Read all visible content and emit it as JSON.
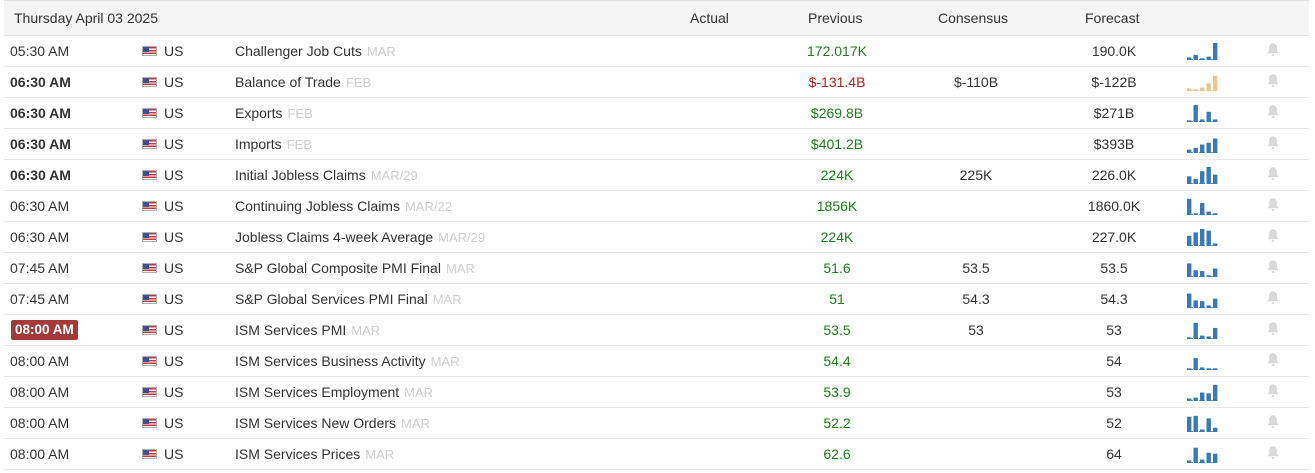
{
  "header": {
    "date": "Thursday April 03 2025",
    "actual": "Actual",
    "previous": "Previous",
    "consensus": "Consensus",
    "forecast": "Forecast"
  },
  "colors": {
    "positive": "#1a7f1a",
    "negative": "#b52020",
    "highlight_time": "#a33a3a",
    "spark_blue": "#3a79b7",
    "spark_warn": "#ecc88c"
  },
  "rows": [
    {
      "time": "05:30 AM",
      "bold": false,
      "highlight": false,
      "country": "US",
      "event": "Challenger Job Cuts",
      "ref": "MAR",
      "actual": "",
      "previous": "172.017K",
      "prev_tone": "pos",
      "consensus": "",
      "forecast": "190.0K",
      "spark": [
        0.15,
        0.3,
        0.1,
        0.2,
        1.0
      ],
      "spark_style": "blue"
    },
    {
      "time": "06:30 AM",
      "bold": true,
      "highlight": false,
      "country": "US",
      "event": "Balance of Trade",
      "ref": "FEB",
      "actual": "",
      "previous": "$-131.4B",
      "prev_tone": "neg",
      "consensus": "$-110B",
      "forecast": "$-122B",
      "spark": [
        0.15,
        0.1,
        0.2,
        0.45,
        0.9
      ],
      "spark_style": "warn"
    },
    {
      "time": "06:30 AM",
      "bold": true,
      "highlight": false,
      "country": "US",
      "event": "Exports",
      "ref": "FEB",
      "actual": "",
      "previous": "$269.8B",
      "prev_tone": "pos",
      "consensus": "",
      "forecast": "$271B",
      "spark": [
        0.1,
        1.0,
        0.15,
        0.6,
        0.15
      ],
      "spark_style": "blue"
    },
    {
      "time": "06:30 AM",
      "bold": true,
      "highlight": false,
      "country": "US",
      "event": "Imports",
      "ref": "FEB",
      "actual": "",
      "previous": "$401.2B",
      "prev_tone": "pos",
      "consensus": "",
      "forecast": "$393B",
      "spark": [
        0.2,
        0.3,
        0.5,
        0.6,
        0.85
      ],
      "spark_style": "blue"
    },
    {
      "time": "06:30 AM",
      "bold": true,
      "highlight": false,
      "country": "US",
      "event": "Initial Jobless Claims",
      "ref": "MAR/29",
      "actual": "",
      "previous": "224K",
      "prev_tone": "pos",
      "consensus": "225K",
      "forecast": "226.0K",
      "spark": [
        0.45,
        0.3,
        0.75,
        1.0,
        0.55
      ],
      "spark_style": "blue"
    },
    {
      "time": "06:30 AM",
      "bold": false,
      "highlight": false,
      "country": "US",
      "event": "Continuing Jobless Claims",
      "ref": "MAR/22",
      "actual": "",
      "previous": "1856K",
      "prev_tone": "pos",
      "consensus": "",
      "forecast": "1860.0K",
      "spark": [
        0.95,
        0.1,
        0.7,
        0.2,
        0.1
      ],
      "spark_style": "blue"
    },
    {
      "time": "06:30 AM",
      "bold": false,
      "highlight": false,
      "country": "US",
      "event": "Jobless Claims 4-week Average",
      "ref": "MAR/29",
      "actual": "",
      "previous": "224K",
      "prev_tone": "pos",
      "consensus": "",
      "forecast": "227.0K",
      "spark": [
        0.6,
        0.8,
        1.0,
        0.9,
        0.15
      ],
      "spark_style": "blue"
    },
    {
      "time": "07:45 AM",
      "bold": false,
      "highlight": false,
      "country": "US",
      "event": "S&P Global Composite PMI Final",
      "ref": "MAR",
      "actual": "",
      "previous": "51.6",
      "prev_tone": "pos",
      "consensus": "53.5",
      "forecast": "53.5",
      "spark": [
        0.8,
        0.4,
        0.35,
        0.1,
        0.5
      ],
      "spark_style": "blue"
    },
    {
      "time": "07:45 AM",
      "bold": false,
      "highlight": false,
      "country": "US",
      "event": "S&P Global Services PMI Final",
      "ref": "MAR",
      "actual": "",
      "previous": "51",
      "prev_tone": "pos",
      "consensus": "54.3",
      "forecast": "54.3",
      "spark": [
        0.85,
        0.45,
        0.4,
        0.15,
        0.55
      ],
      "spark_style": "blue"
    },
    {
      "time": "08:00 AM",
      "bold": true,
      "highlight": true,
      "country": "US",
      "event": "ISM Services PMI",
      "ref": "MAR",
      "actual": "",
      "previous": "53.5",
      "prev_tone": "pos",
      "consensus": "53",
      "forecast": "53",
      "spark": [
        0.1,
        0.95,
        0.2,
        0.15,
        0.65
      ],
      "spark_style": "blue"
    },
    {
      "time": "08:00 AM",
      "bold": false,
      "highlight": false,
      "country": "US",
      "event": "ISM Services Business Activity",
      "ref": "MAR",
      "actual": "",
      "previous": "54.4",
      "prev_tone": "pos",
      "consensus": "",
      "forecast": "54",
      "spark": [
        0.1,
        0.7,
        0.15,
        0.1,
        0.1
      ],
      "spark_style": "blue"
    },
    {
      "time": "08:00 AM",
      "bold": false,
      "highlight": false,
      "country": "US",
      "event": "ISM Services Employment",
      "ref": "MAR",
      "actual": "",
      "previous": "53.9",
      "prev_tone": "pos",
      "consensus": "",
      "forecast": "53",
      "spark": [
        0.15,
        0.2,
        0.5,
        0.45,
        0.95
      ],
      "spark_style": "blue"
    },
    {
      "time": "08:00 AM",
      "bold": false,
      "highlight": false,
      "country": "US",
      "event": "ISM Services New Orders",
      "ref": "MAR",
      "actual": "",
      "previous": "52.2",
      "prev_tone": "pos",
      "consensus": "",
      "forecast": "52",
      "spark": [
        0.9,
        0.95,
        0.15,
        0.8,
        0.25
      ],
      "spark_style": "blue"
    },
    {
      "time": "08:00 AM",
      "bold": false,
      "highlight": false,
      "country": "US",
      "event": "ISM Services Prices",
      "ref": "MAR",
      "actual": "",
      "previous": "62.6",
      "prev_tone": "pos",
      "consensus": "",
      "forecast": "64",
      "spark": [
        0.15,
        0.9,
        0.2,
        0.6,
        0.55
      ],
      "spark_style": "blue"
    }
  ]
}
